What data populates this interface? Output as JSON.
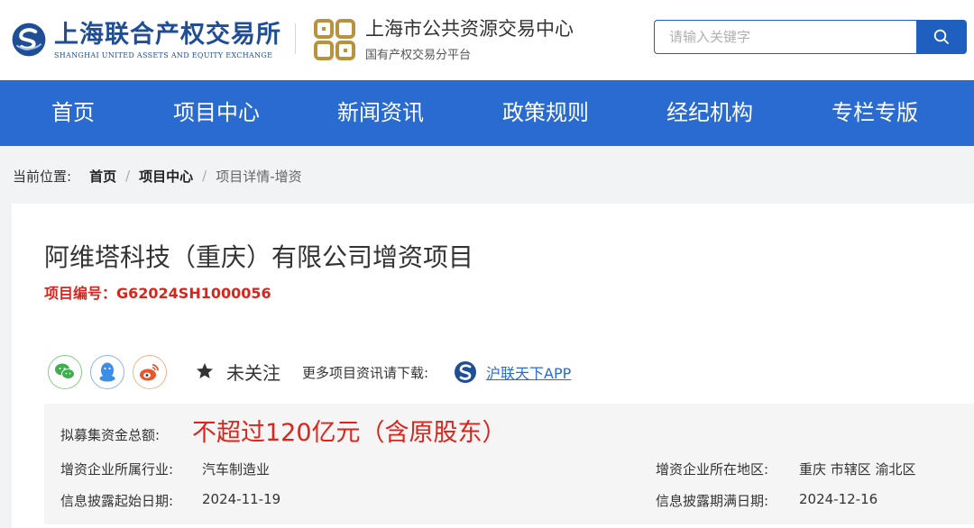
{
  "header": {
    "org_name_cn": "上海联合产权交易所",
    "org_name_en": "SHANGHAI UNITED ASSETS AND EQUITY EXCHANGE",
    "platform_title": "上海市公共资源交易中心",
    "platform_subtitle": "国有产权交易分平台",
    "search_placeholder": "请输入关键字",
    "search_icon": "search-icon"
  },
  "nav": {
    "items": [
      {
        "label": "首页"
      },
      {
        "label": "项目中心"
      },
      {
        "label": "新闻资讯"
      },
      {
        "label": "政策规则"
      },
      {
        "label": "经纪机构"
      },
      {
        "label": "专栏专版"
      }
    ]
  },
  "breadcrumb": {
    "prefix": "当前位置:",
    "items": [
      "首页",
      "项目中心"
    ],
    "separator": "/",
    "current": "项目详情-增资"
  },
  "project": {
    "title": "阿维塔科技（重庆）有限公司增资项目",
    "code": "项目编号：G62024SH1000056",
    "share_icons": [
      "wechat-icon",
      "qq-icon",
      "weibo-icon"
    ],
    "follow_label": "未关注",
    "more_text": "更多项目资讯请下载:",
    "app_label": "沪联天下APP",
    "fund_label": "拟募集资金总额:",
    "fund_value": "不超过120亿元（含原股东）",
    "industry_label": "增资企业所属行业:",
    "industry_value": "汽车制造业",
    "region_label": "增资企业所在地区:",
    "region_value": "重庆 市辖区 渝北区",
    "start_label": "信息披露起始日期:",
    "start_value": "2024-11-19",
    "end_label": "信息披露期满日期:",
    "end_value": "2024-12-16"
  },
  "colors": {
    "brand_blue": "#2a6bd1",
    "logo_blue": "#1f4e96",
    "logo_gold": "#b8933e",
    "accent_red": "#d9261c",
    "wechat_green": "#3fae4f",
    "qq_blue": "#3a8ee6",
    "weibo_orange": "#e8562a"
  }
}
